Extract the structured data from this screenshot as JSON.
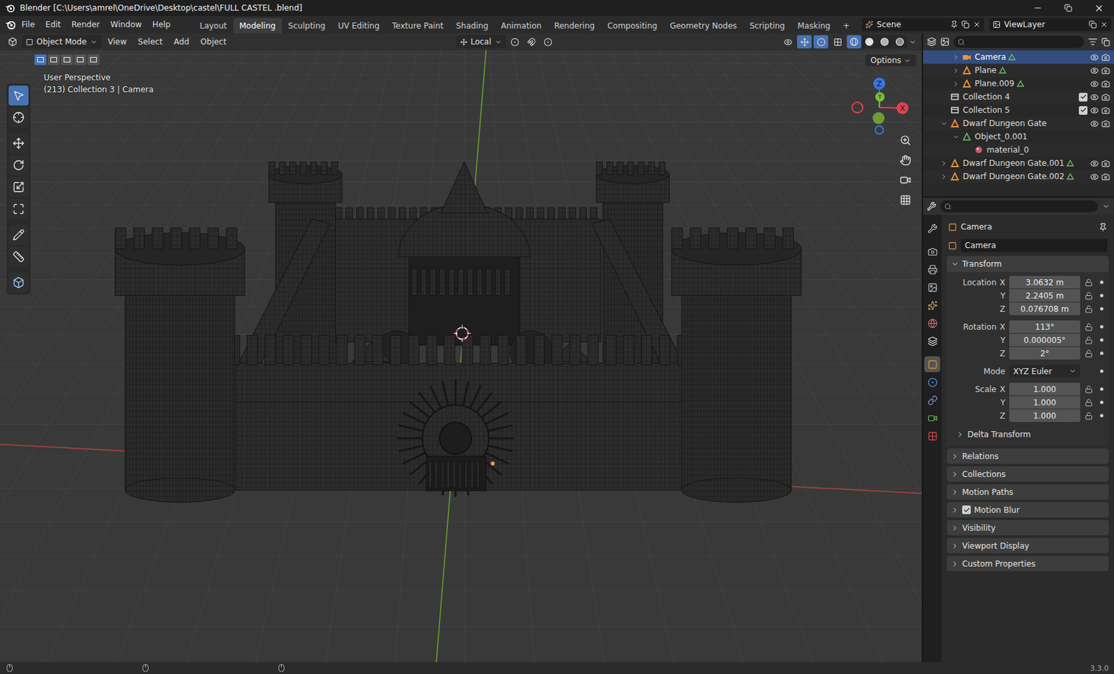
{
  "window": {
    "title": "Blender [C:\\Users\\amrel\\OneDrive\\Desktop\\castel\\FULL CASTEL .blend]"
  },
  "menu": [
    "File",
    "Edit",
    "Render",
    "Window",
    "Help"
  ],
  "workspaces": [
    {
      "label": "Layout",
      "selected": false
    },
    {
      "label": "Modeling",
      "selected": true
    },
    {
      "label": "Sculpting",
      "selected": false
    },
    {
      "label": "UV Editing",
      "selected": false
    },
    {
      "label": "Texture Paint",
      "selected": false
    },
    {
      "label": "Shading",
      "selected": false
    },
    {
      "label": "Animation",
      "selected": false
    },
    {
      "label": "Rendering",
      "selected": false
    },
    {
      "label": "Compositing",
      "selected": false
    },
    {
      "label": "Geometry Nodes",
      "selected": false
    },
    {
      "label": "Scripting",
      "selected": false
    },
    {
      "label": "Masking",
      "selected": false
    }
  ],
  "workspace_add": "+",
  "scene": "Scene",
  "view_layer": "ViewLayer",
  "viewport": {
    "mode": "Object Mode",
    "menus": [
      "View",
      "Select",
      "Add",
      "Object"
    ],
    "orientation": "Local",
    "options": "Options",
    "view_name": "User Perspective",
    "context": "(213) Collection 3 | Camera",
    "select_modes": [
      {
        "selected": true
      },
      {
        "selected": false
      },
      {
        "selected": false
      },
      {
        "selected": false
      },
      {
        "selected": false
      }
    ],
    "tools": [
      {
        "kind": "select",
        "selected": true
      },
      {
        "kind": "cursor",
        "selected": false
      },
      {
        "kind": "move",
        "selected": false
      },
      {
        "kind": "rotate",
        "selected": false
      },
      {
        "kind": "scale",
        "selected": false
      },
      {
        "kind": "transform",
        "selected": false
      },
      {
        "kind": "annotate",
        "selected": false
      },
      {
        "kind": "measure",
        "selected": false
      },
      {
        "kind": "add-cube",
        "selected": false
      }
    ],
    "shading": [
      {
        "kind": "wireframe",
        "selected": true
      },
      {
        "kind": "solid",
        "selected": false
      },
      {
        "kind": "material",
        "selected": false
      },
      {
        "kind": "rendered",
        "selected": false
      }
    ],
    "axes": [
      {
        "label": "Z",
        "color": "#3b74e0"
      },
      {
        "label": "X",
        "color": "#e0424d"
      },
      {
        "label": "Y",
        "color": "#7fbf33"
      }
    ]
  },
  "outliner": {
    "rows": [
      {
        "name": "Camera",
        "kind": "camera",
        "depth": 1,
        "has_children": true,
        "expanded": false,
        "selected": true,
        "data_icon": true,
        "has_checkbox": false,
        "checked": false,
        "toggles": true
      },
      {
        "name": "Plane",
        "kind": "mesh",
        "depth": 1,
        "has_children": true,
        "expanded": false,
        "selected": false,
        "data_icon": true,
        "has_checkbox": false,
        "checked": false,
        "toggles": true
      },
      {
        "name": "Plane.009",
        "kind": "mesh",
        "depth": 1,
        "has_children": true,
        "expanded": false,
        "selected": false,
        "data_icon": true,
        "has_checkbox": false,
        "checked": false,
        "toggles": true
      },
      {
        "name": "Collection 4",
        "kind": "collection",
        "depth": 0,
        "has_children": false,
        "expanded": false,
        "selected": false,
        "data_icon": false,
        "has_checkbox": true,
        "checked": true,
        "toggles": true
      },
      {
        "name": "Collection 5",
        "kind": "collection",
        "depth": 0,
        "has_children": false,
        "expanded": false,
        "selected": false,
        "data_icon": false,
        "has_checkbox": true,
        "checked": true,
        "toggles": true
      },
      {
        "name": "Dwarf Dungeon Gate",
        "kind": "mesh",
        "depth": 0,
        "has_children": true,
        "expanded": true,
        "selected": false,
        "data_icon": false,
        "has_checkbox": false,
        "checked": false,
        "toggles": true
      },
      {
        "name": "Object_0.001",
        "kind": "object_data",
        "depth": 1,
        "has_children": true,
        "expanded": true,
        "selected": false,
        "data_icon": false,
        "has_checkbox": false,
        "checked": false,
        "toggles": false
      },
      {
        "name": "material_0",
        "kind": "material",
        "depth": 2,
        "has_children": false,
        "expanded": false,
        "selected": false,
        "data_icon": false,
        "has_checkbox": false,
        "checked": false,
        "toggles": false
      },
      {
        "name": "Dwarf Dungeon Gate.001",
        "kind": "mesh",
        "depth": 0,
        "has_children": true,
        "expanded": false,
        "selected": false,
        "data_icon": true,
        "has_checkbox": false,
        "checked": false,
        "toggles": true
      },
      {
        "name": "Dwarf Dungeon Gate.002",
        "kind": "mesh",
        "depth": 0,
        "has_children": true,
        "expanded": false,
        "selected": false,
        "data_icon": true,
        "has_checkbox": false,
        "checked": false,
        "toggles": true
      }
    ]
  },
  "properties": {
    "tabs": [
      {
        "kind": "tool",
        "selected": false
      },
      {
        "kind": "render",
        "selected": false
      },
      {
        "kind": "output",
        "selected": false
      },
      {
        "kind": "view-layer",
        "selected": false
      },
      {
        "kind": "scene",
        "selected": false
      },
      {
        "kind": "world",
        "selected": false
      },
      {
        "kind": "collection",
        "selected": false
      },
      {
        "kind": "object",
        "selected": true
      },
      {
        "kind": "physics",
        "selected": false
      },
      {
        "kind": "constraints",
        "selected": false
      },
      {
        "kind": "data",
        "selected": false
      },
      {
        "kind": "texture",
        "selected": false
      }
    ],
    "object": "Camera",
    "data_name": "Camera",
    "transform": {
      "title": "Transform",
      "expanded": true,
      "groups": [
        {
          "label": "Location",
          "fields": [
            {
              "axis": "X",
              "value": "3.0632 m"
            },
            {
              "axis": "Y",
              "value": "2.2405 m"
            },
            {
              "axis": "Z",
              "value": "0.076708 m"
            }
          ]
        },
        {
          "label": "Rotation",
          "fields": [
            {
              "axis": "X",
              "value": "113°"
            },
            {
              "axis": "Y",
              "value": "0.000005°"
            },
            {
              "axis": "Z",
              "value": "2°"
            }
          ]
        }
      ],
      "mode_label": "Mode",
      "mode": "XYZ Euler",
      "scale": {
        "label": "Scale",
        "fields": [
          {
            "axis": "X",
            "value": "1.000"
          },
          {
            "axis": "Y",
            "value": "1.000"
          },
          {
            "axis": "Z",
            "value": "1.000"
          }
        ]
      },
      "subpanel": {
        "label": "Delta Transform",
        "expanded": false
      }
    },
    "panels": [
      {
        "label": "Relations",
        "expanded": false,
        "has_checkbox": false,
        "checked": false
      },
      {
        "label": "Collections",
        "expanded": false,
        "has_checkbox": false,
        "checked": false
      },
      {
        "label": "Motion Paths",
        "expanded": false,
        "has_checkbox": false,
        "checked": false
      },
      {
        "label": "Motion Blur",
        "expanded": false,
        "has_checkbox": true,
        "checked": true
      },
      {
        "label": "Visibility",
        "expanded": false,
        "has_checkbox": false,
        "checked": false
      },
      {
        "label": "Viewport Display",
        "expanded": false,
        "has_checkbox": false,
        "checked": false
      },
      {
        "label": "Custom Properties",
        "expanded": false,
        "has_checkbox": false,
        "checked": false
      }
    ]
  },
  "status": {
    "version": "3.3.0"
  }
}
